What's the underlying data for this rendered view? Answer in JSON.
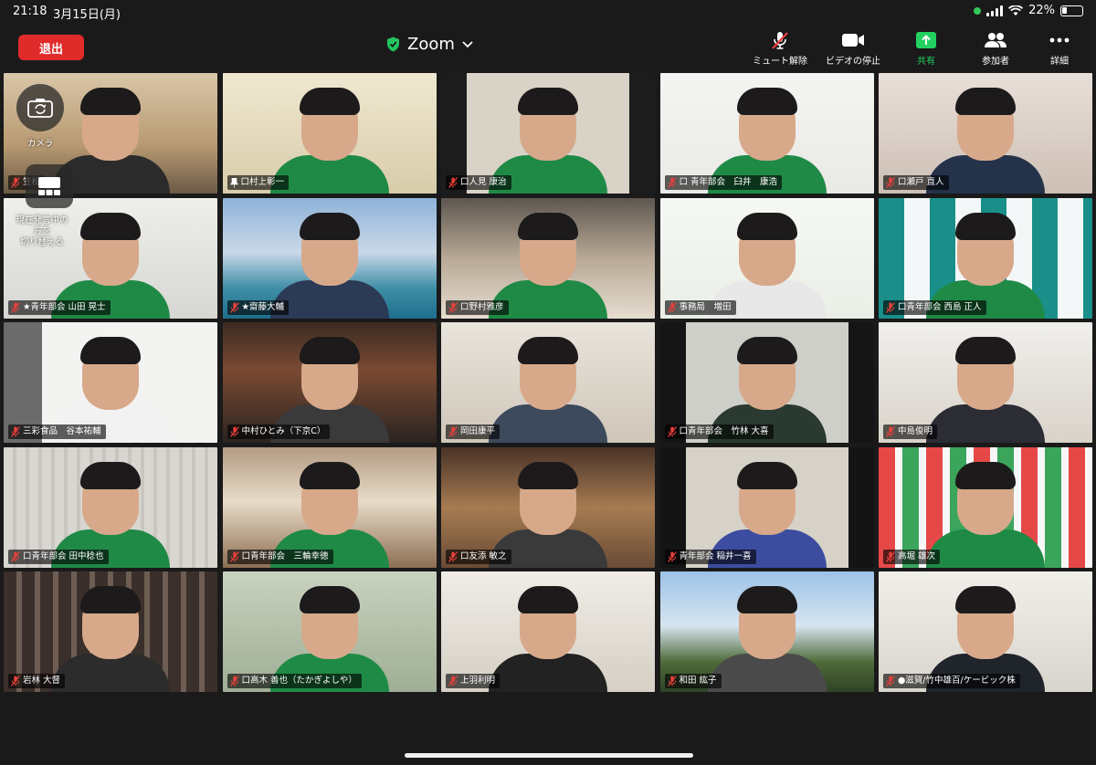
{
  "status_bar": {
    "time": "21:18",
    "date": "3月15日(月)",
    "battery": "22%"
  },
  "toolbar": {
    "leave_label": "退出",
    "title": "Zoom",
    "tools": [
      {
        "label": "ミュート解除",
        "icon": "mic-off-icon"
      },
      {
        "label": "ビデオの停止",
        "icon": "video-camera-icon"
      },
      {
        "label": "共有",
        "icon": "share-screen-icon",
        "color": "#23d160"
      },
      {
        "label": "参加者",
        "icon": "participants-icon"
      },
      {
        "label": "詳細",
        "icon": "more-dots-icon"
      }
    ]
  },
  "overlay": {
    "camera_label": "カメラ",
    "switch_label_1": "現在発言中の",
    "switch_label_2": "方を",
    "switch_label_3": "切り替える"
  },
  "participants": [
    {
      "name": "笠松"
    },
    {
      "name": "口村上彰一",
      "active": true
    },
    {
      "name": "口人見 康治"
    },
    {
      "name": "口 青年部会　臼井　康浩"
    },
    {
      "name": "口瀬戸 直人"
    },
    {
      "name": "★青年部会 山田 晃士"
    },
    {
      "name": "★齋藤大輔"
    },
    {
      "name": "口野村雅彦"
    },
    {
      "name": "事務局　増田"
    },
    {
      "name": "口青年部会 西島 正人"
    },
    {
      "name": "三彩食品　谷本祐輔"
    },
    {
      "name": "中村ひとみ（下京C）"
    },
    {
      "name": "岡田康平"
    },
    {
      "name": "口青年部会　竹林 大喜"
    },
    {
      "name": "中島俊明"
    },
    {
      "name": "口青年部会 田中稔也"
    },
    {
      "name": "口青年部会　三輪幸徳"
    },
    {
      "name": "口友添 敏之"
    },
    {
      "name": "青年部会 稲井一喜"
    },
    {
      "name": "高堀 雄次"
    },
    {
      "name": "岩林 大督"
    },
    {
      "name": "口高木 善也（たかぎよしや）"
    },
    {
      "name": "上羽利明"
    },
    {
      "name": "和田 紘子"
    },
    {
      "name": "●滋賀/竹中雄百/ケービック株"
    }
  ],
  "colors": {
    "accent_green": "#3bd16f",
    "leave_red": "#e02b2b",
    "mic_red": "#e8403a"
  }
}
